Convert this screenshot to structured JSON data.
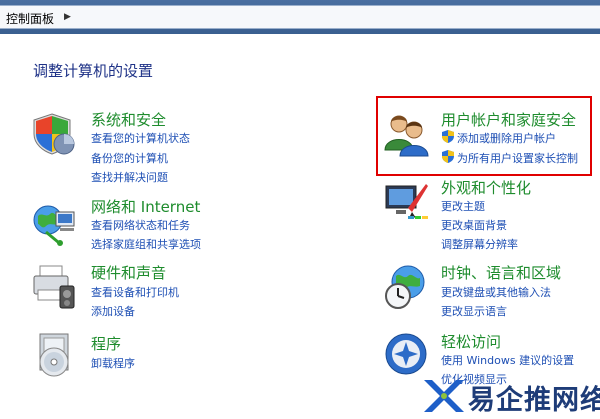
{
  "address": {
    "crumb": "控制面板"
  },
  "page_heading": "调整计算机的设置",
  "categories": {
    "system": {
      "title": "系统和安全",
      "links": [
        "查看您的计算机状态",
        "备份您的计算机",
        "查找并解决问题"
      ]
    },
    "network": {
      "title": "网络和 Internet",
      "links": [
        "查看网络状态和任务",
        "选择家庭组和共享选项"
      ]
    },
    "hardware": {
      "title": "硬件和声音",
      "links": [
        "查看设备和打印机",
        "添加设备"
      ]
    },
    "programs": {
      "title": "程序",
      "links": [
        "卸载程序"
      ]
    },
    "users": {
      "title": "用户帐户和家庭安全",
      "links": [
        "添加或删除用户帐户",
        "为所有用户设置家长控制"
      ]
    },
    "appearance": {
      "title": "外观和个性化",
      "links": [
        "更改主题",
        "更改桌面背景",
        "调整屏幕分辨率"
      ]
    },
    "clock": {
      "title": "时钟、语言和区域",
      "links": [
        "更改键盘或其他输入法",
        "更改显示语言"
      ]
    },
    "ease": {
      "title": "轻松访问",
      "links": [
        "使用 Windows 建议的设置",
        "优化视频显示"
      ]
    }
  },
  "watermark": {
    "text": "易企推网络"
  },
  "colors": {
    "title_green": "#1e8c2d",
    "link_blue": "#1e4fb4",
    "heading_blue": "#1e3287",
    "highlight_red": "#e00000"
  }
}
